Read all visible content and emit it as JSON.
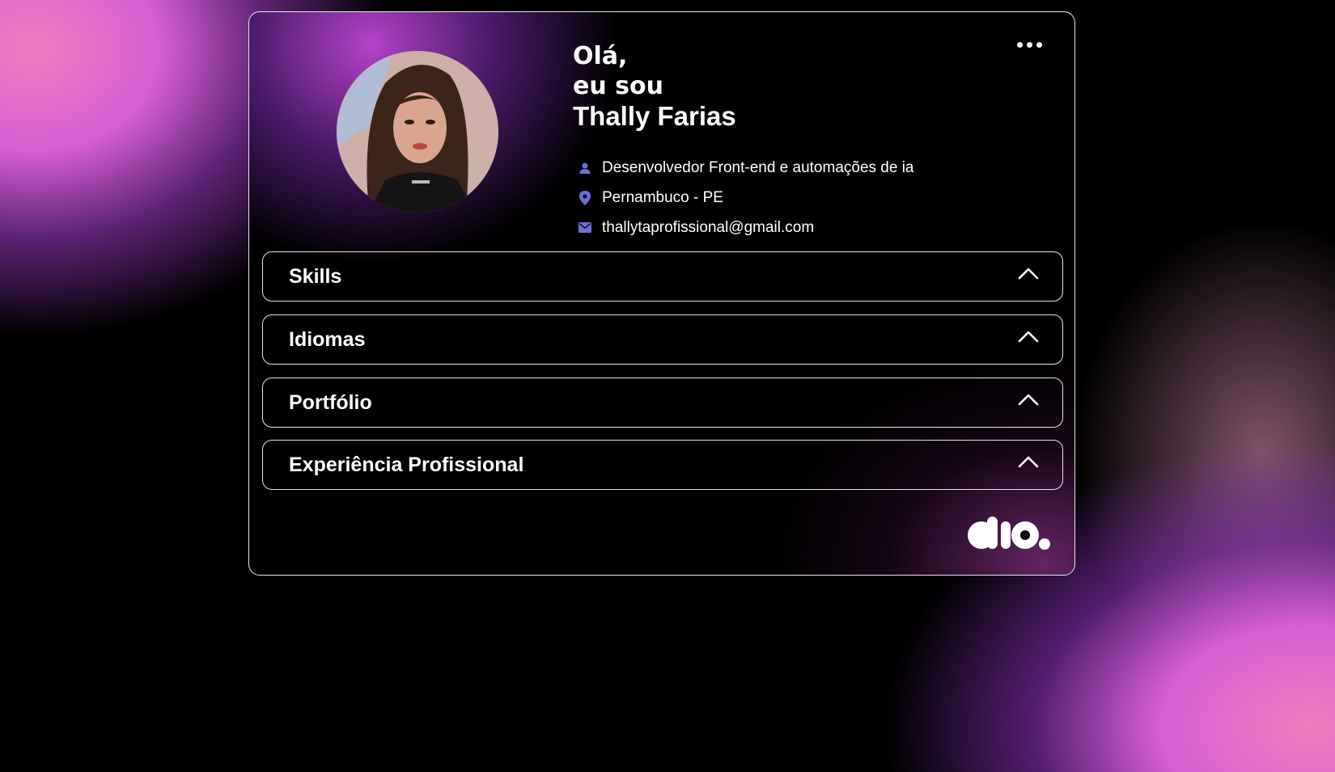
{
  "header": {
    "greeting_line1": "Olá,",
    "greeting_line2": "eu sou",
    "name": "Thally Farias"
  },
  "menu": {
    "icon": "more-horizontal-icon"
  },
  "profile": {
    "avatar": "profile-photo",
    "info": [
      {
        "icon": "user-icon",
        "text": "Desenvolvedor Front-end e automações de ia"
      },
      {
        "icon": "location-pin-icon",
        "text": "Pernambuco - PE"
      },
      {
        "icon": "mail-icon",
        "text": "thallytaprofissional@gmail.com"
      }
    ]
  },
  "sections": [
    {
      "label": "Skills",
      "icon": "chevron-up-icon"
    },
    {
      "label": "Idiomas",
      "icon": "chevron-up-icon"
    },
    {
      "label": "Portfólio",
      "icon": "chevron-up-icon"
    },
    {
      "label": "Experiência Profissional",
      "icon": "chevron-up-icon"
    }
  ],
  "footer": {
    "logo": "dio-logo"
  },
  "colors": {
    "icon_accent": "#6f6fd8",
    "border": "#e6e6e6",
    "background": "#000000",
    "gradient_pink": "#f07cbb",
    "gradient_purple": "#d85fd6"
  }
}
